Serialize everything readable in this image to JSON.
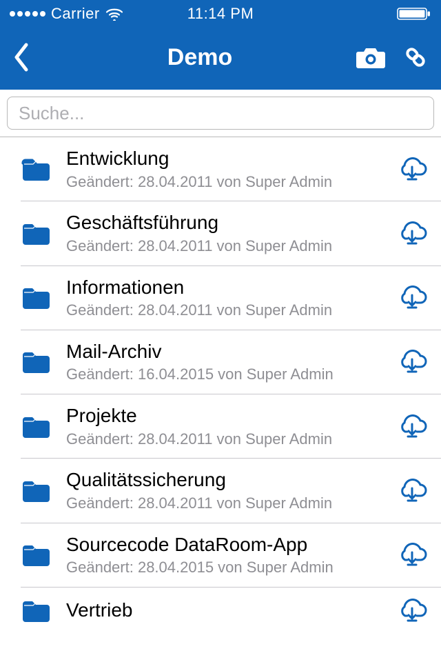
{
  "status_bar": {
    "carrier": "Carrier",
    "time": "11:14 PM"
  },
  "nav": {
    "title": "Demo"
  },
  "search": {
    "placeholder": "Suche..."
  },
  "list": {
    "items": [
      {
        "title": "Entwicklung",
        "subtitle": "Geändert: 28.04.2011 von Super Admin"
      },
      {
        "title": "Geschäftsführung",
        "subtitle": "Geändert: 28.04.2011 von Super Admin"
      },
      {
        "title": "Informationen",
        "subtitle": "Geändert: 28.04.2011 von Super Admin"
      },
      {
        "title": "Mail-Archiv",
        "subtitle": "Geändert: 16.04.2015 von Super Admin"
      },
      {
        "title": "Projekte",
        "subtitle": "Geändert: 28.04.2011 von Super Admin"
      },
      {
        "title": "Qualitätssicherung",
        "subtitle": "Geändert: 28.04.2011 von Super Admin"
      },
      {
        "title": "Sourcecode DataRoom-App",
        "subtitle": "Geändert: 28.04.2015 von Super Admin"
      },
      {
        "title": "Vertrieb",
        "subtitle": ""
      }
    ]
  },
  "colors": {
    "primary": "#1065b8",
    "subtitle": "#8e8e93",
    "separator": "#c8c7cc"
  }
}
